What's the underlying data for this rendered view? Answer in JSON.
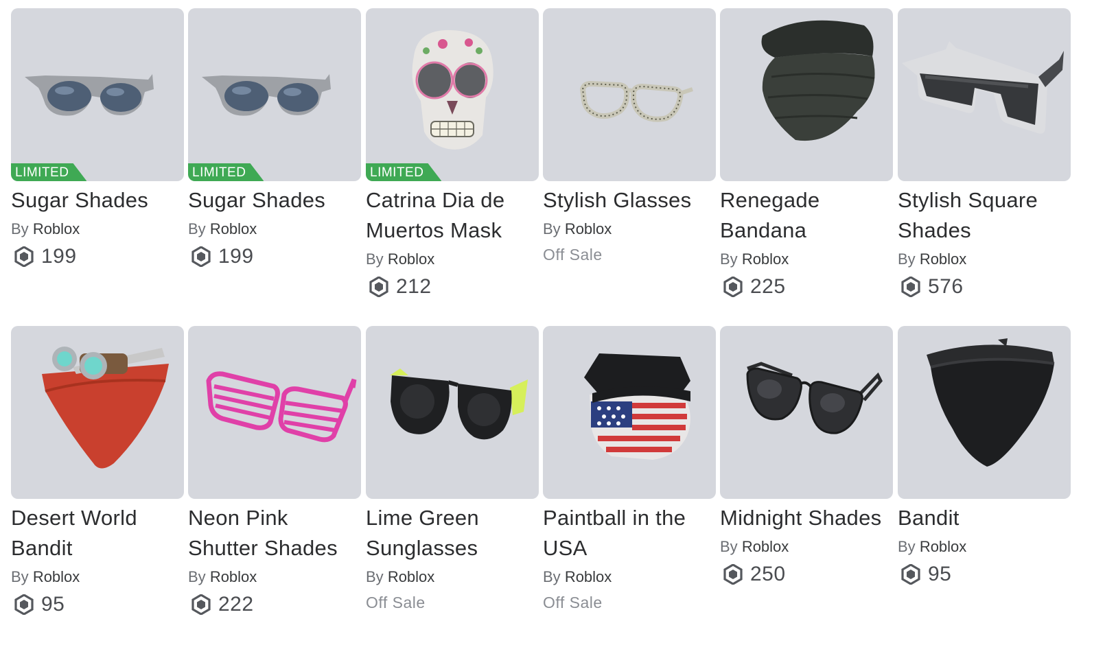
{
  "catalog": {
    "items": [
      {
        "name": "Sugar Shades",
        "by_prefix": "By",
        "creator": "Roblox",
        "badge": "LIMITED",
        "price": "199",
        "icon": "sunglasses-icon"
      },
      {
        "name": "Sugar Shades",
        "by_prefix": "By",
        "creator": "Roblox",
        "badge": "LIMITED",
        "price": "199",
        "icon": "sunglasses-icon"
      },
      {
        "name": "Catrina Dia de Muertos Mask",
        "by_prefix": "By",
        "creator": "Roblox",
        "badge": "LIMITED",
        "price": "212",
        "icon": "skull-mask-icon"
      },
      {
        "name": "Stylish Glasses",
        "by_prefix": "By",
        "creator": "Roblox",
        "status": "Off Sale",
        "icon": "glasses-icon"
      },
      {
        "name": "Renegade Bandana",
        "by_prefix": "By",
        "creator": "Roblox",
        "price": "225",
        "icon": "bandana-icon"
      },
      {
        "name": "Stylish Square Shades",
        "by_prefix": "By",
        "creator": "Roblox",
        "price": "576",
        "icon": "square-shades-icon"
      },
      {
        "name": "Desert World Bandit",
        "by_prefix": "By",
        "creator": "Roblox",
        "price": "95",
        "icon": "goggles-bandana-icon"
      },
      {
        "name": "Neon Pink Shutter Shades",
        "by_prefix": "By",
        "creator": "Roblox",
        "price": "222",
        "icon": "shutter-shades-icon"
      },
      {
        "name": "Lime Green Sunglasses",
        "by_prefix": "By",
        "creator": "Roblox",
        "status": "Off Sale",
        "icon": "sunglasses-icon"
      },
      {
        "name": "Paintball in the USA",
        "by_prefix": "By",
        "creator": "Roblox",
        "status": "Off Sale",
        "icon": "paintball-mask-icon"
      },
      {
        "name": "Midnight Shades",
        "by_prefix": "By",
        "creator": "Roblox",
        "price": "250",
        "icon": "aviator-shades-icon"
      },
      {
        "name": "Bandit",
        "by_prefix": "By",
        "creator": "Roblox",
        "price": "95",
        "icon": "bandana-icon"
      }
    ]
  },
  "colors": {
    "thumb_bg": "#d5d7dd",
    "limited_badge": "#3fa954",
    "offsale_text": "#8a8d93"
  }
}
